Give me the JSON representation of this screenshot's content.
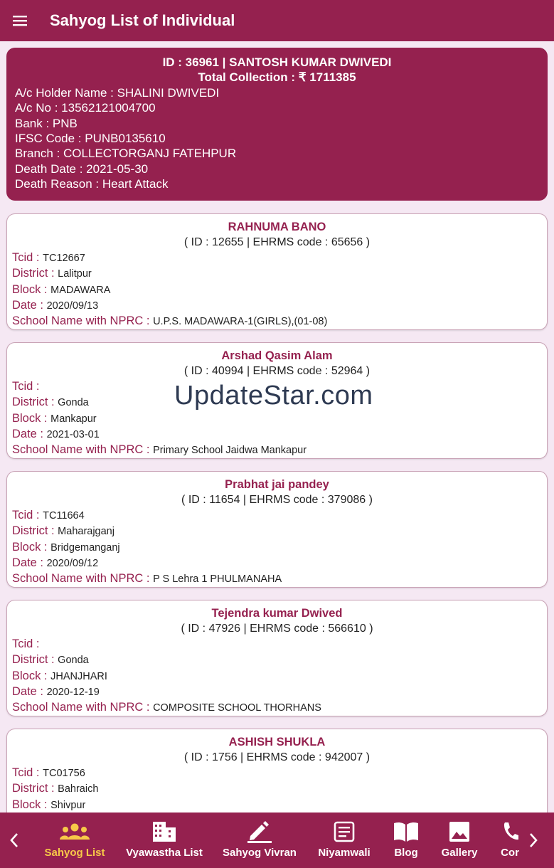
{
  "appbar": {
    "title": "Sahyog List of Individual",
    "menu_icon": "hamburger-menu-icon"
  },
  "summary": {
    "id_line": "ID : 36961 | SANTOSH KUMAR DWIVEDI",
    "total_line": "Total Collection : ₹ 1711385",
    "holder": "A/c Holder Name : SHALINI DWIVEDI",
    "account": "A/c No : 13562121004700",
    "bank": "Bank : PNB",
    "ifsc": "IFSC Code : PUNB0135610",
    "branch": "Branch : COLLECTORGANJ FATEHPUR",
    "death_date": "Death Date : 2021-05-30",
    "death_reason": "Death Reason : Heart Attack"
  },
  "labels": {
    "tcid": "Tcid : ",
    "district": "District : ",
    "block": "Block : ",
    "date": "Date : ",
    "school": "School Name with NPRC : "
  },
  "cards": [
    {
      "name": "RAHNUMA BANO",
      "ids": "( ID : 12655 | EHRMS code : 65656 )",
      "tcid": "TC12667",
      "district": "Lalitpur",
      "block": "MADAWARA",
      "date": "2020/09/13",
      "school": "U.P.S. MADAWARA-1(GIRLS),(01-08)"
    },
    {
      "name": "Arshad Qasim Alam",
      "ids": "( ID : 40994 | EHRMS code : 52964 )",
      "tcid": "",
      "district": "Gonda",
      "block": "Mankapur",
      "date": "2021-03-01",
      "school": "Primary School Jaidwa Mankapur"
    },
    {
      "name": "Prabhat jai pandey",
      "ids": "( ID : 11654 | EHRMS code : 379086 )",
      "tcid": "TC11664",
      "district": "Maharajganj",
      "block": "Bridgemanganj",
      "date": "2020/09/12",
      "school": "P S Lehra 1 PHULMANAHA"
    },
    {
      "name": "Tejendra kumar Dwived",
      "ids": "( ID : 47926 | EHRMS code : 566610 )",
      "tcid": "",
      "district": "Gonda",
      "block": "JHANJHARI",
      "date": "2020-12-19",
      "school": "COMPOSITE SCHOOL THORHANS"
    },
    {
      "name": "ASHISH SHUKLA",
      "ids": "( ID : 1756 | EHRMS code : 942007 )",
      "tcid": "TC01756",
      "district": "Bahraich",
      "block": "Shivpur",
      "date": "",
      "school": ""
    }
  ],
  "watermark": "UpdateStar.com",
  "nav": {
    "prev_icon": "chevron-left-icon",
    "next_icon": "chevron-right-icon",
    "items": [
      {
        "label": "Sahyog List",
        "icon": "group-icon",
        "active": true
      },
      {
        "label": "Vyawastha List",
        "icon": "building-icon",
        "active": false
      },
      {
        "label": "Sahyog Vivran",
        "icon": "edit-pencil-icon",
        "active": false
      },
      {
        "label": "Niyamwali",
        "icon": "article-icon",
        "active": false
      },
      {
        "label": "Blog",
        "icon": "book-icon",
        "active": false
      },
      {
        "label": "Gallery",
        "icon": "image-icon",
        "active": false
      },
      {
        "label": "Cor",
        "icon": "phone-icon",
        "active": false
      }
    ],
    "active_color": "#f7c948"
  },
  "colors": {
    "primary": "#95214f",
    "background": "#f5e8f3"
  }
}
